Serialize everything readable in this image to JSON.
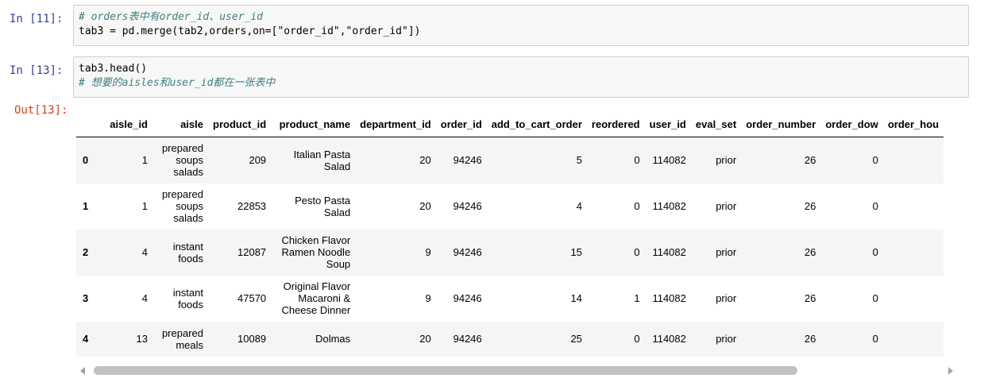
{
  "cells": [
    {
      "prompt": "In  [11]:",
      "lines": [
        {
          "comment": "# orders表中有order_id、user_id"
        },
        {
          "code": "tab3 = pd.merge(tab2,orders,on=[\"order_id\",\"order_id\"])"
        }
      ]
    },
    {
      "prompt": "In  [13]:",
      "lines": [
        {
          "code": "tab3.head()"
        },
        {
          "comment": "# 想要的aisles和user_id都在一张表中"
        }
      ]
    }
  ],
  "output": {
    "prompt": "Out[13]:",
    "columns": [
      "",
      "aisle_id",
      "aisle",
      "product_id",
      "product_name",
      "department_id",
      "order_id",
      "add_to_cart_order",
      "reordered",
      "user_id",
      "eval_set",
      "order_number",
      "order_dow",
      "order_hou"
    ],
    "rows": [
      [
        "0",
        "1",
        "prepared soups salads",
        "209",
        "Italian Pasta Salad",
        "20",
        "94246",
        "5",
        "0",
        "114082",
        "prior",
        "26",
        "0",
        ""
      ],
      [
        "1",
        "1",
        "prepared soups salads",
        "22853",
        "Pesto Pasta Salad",
        "20",
        "94246",
        "4",
        "0",
        "114082",
        "prior",
        "26",
        "0",
        ""
      ],
      [
        "2",
        "4",
        "instant foods",
        "12087",
        "Chicken Flavor Ramen Noodle Soup",
        "9",
        "94246",
        "15",
        "0",
        "114082",
        "prior",
        "26",
        "0",
        ""
      ],
      [
        "3",
        "4",
        "instant foods",
        "47570",
        "Original Flavor Macaroni & Cheese Dinner",
        "9",
        "94246",
        "14",
        "1",
        "114082",
        "prior",
        "26",
        "0",
        ""
      ],
      [
        "4",
        "13",
        "prepared meals",
        "10089",
        "Dolmas",
        "20",
        "94246",
        "25",
        "0",
        "114082",
        "prior",
        "26",
        "0",
        ""
      ]
    ]
  }
}
